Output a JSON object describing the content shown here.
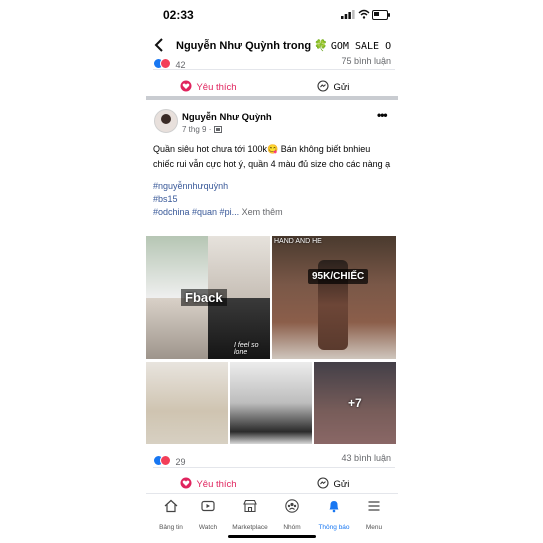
{
  "status_bar": {
    "time": "02:33"
  },
  "header": {
    "title_prefix": "Nguyễn Như Quỳnh trong 🍀",
    "title_suffix": "GOM SALE ORD..."
  },
  "prev_post": {
    "reaction_count": "42",
    "comment_count": "75 bình luận",
    "like_label": "Yêu thích",
    "comment_label": "Gửi"
  },
  "post": {
    "author": "Nguyễn Như Quỳnh",
    "date": "7 thg 9 ·",
    "text": "Quần siêu hot chưa tới 100k😋 Bán không biết bnhieu chiếc rui vẫn cực hot ý, quần 4 màu đủ size cho các nàng ạ",
    "tag1": "#nguyễnnhưquỳnh",
    "tag2": "#bs15",
    "tag3": "#odchina #quan #pi...",
    "see_more": "Xem thêm",
    "photo_labels": {
      "fback": "Fback",
      "feel": "I feel so lone",
      "hand_and": "HAND AND HE",
      "price": "95K/CHIẾC",
      "more_count": "+7"
    },
    "reaction_count": "29",
    "comment_count": "43 bình luận",
    "like_label": "Yêu thích",
    "comment_label": "Gửi"
  },
  "nav": {
    "items": [
      {
        "label": "Bảng tin",
        "icon": "home-icon"
      },
      {
        "label": "Watch",
        "icon": "watch-icon"
      },
      {
        "label": "Marketplace",
        "icon": "marketplace-icon"
      },
      {
        "label": "Nhóm",
        "icon": "groups-icon"
      },
      {
        "label": "Thông báo",
        "icon": "bell-icon"
      },
      {
        "label": "Menu",
        "icon": "menu-icon"
      }
    ]
  },
  "colors": {
    "accent": "#1877f2",
    "like": "#e0245e",
    "love": "#f33e58"
  }
}
